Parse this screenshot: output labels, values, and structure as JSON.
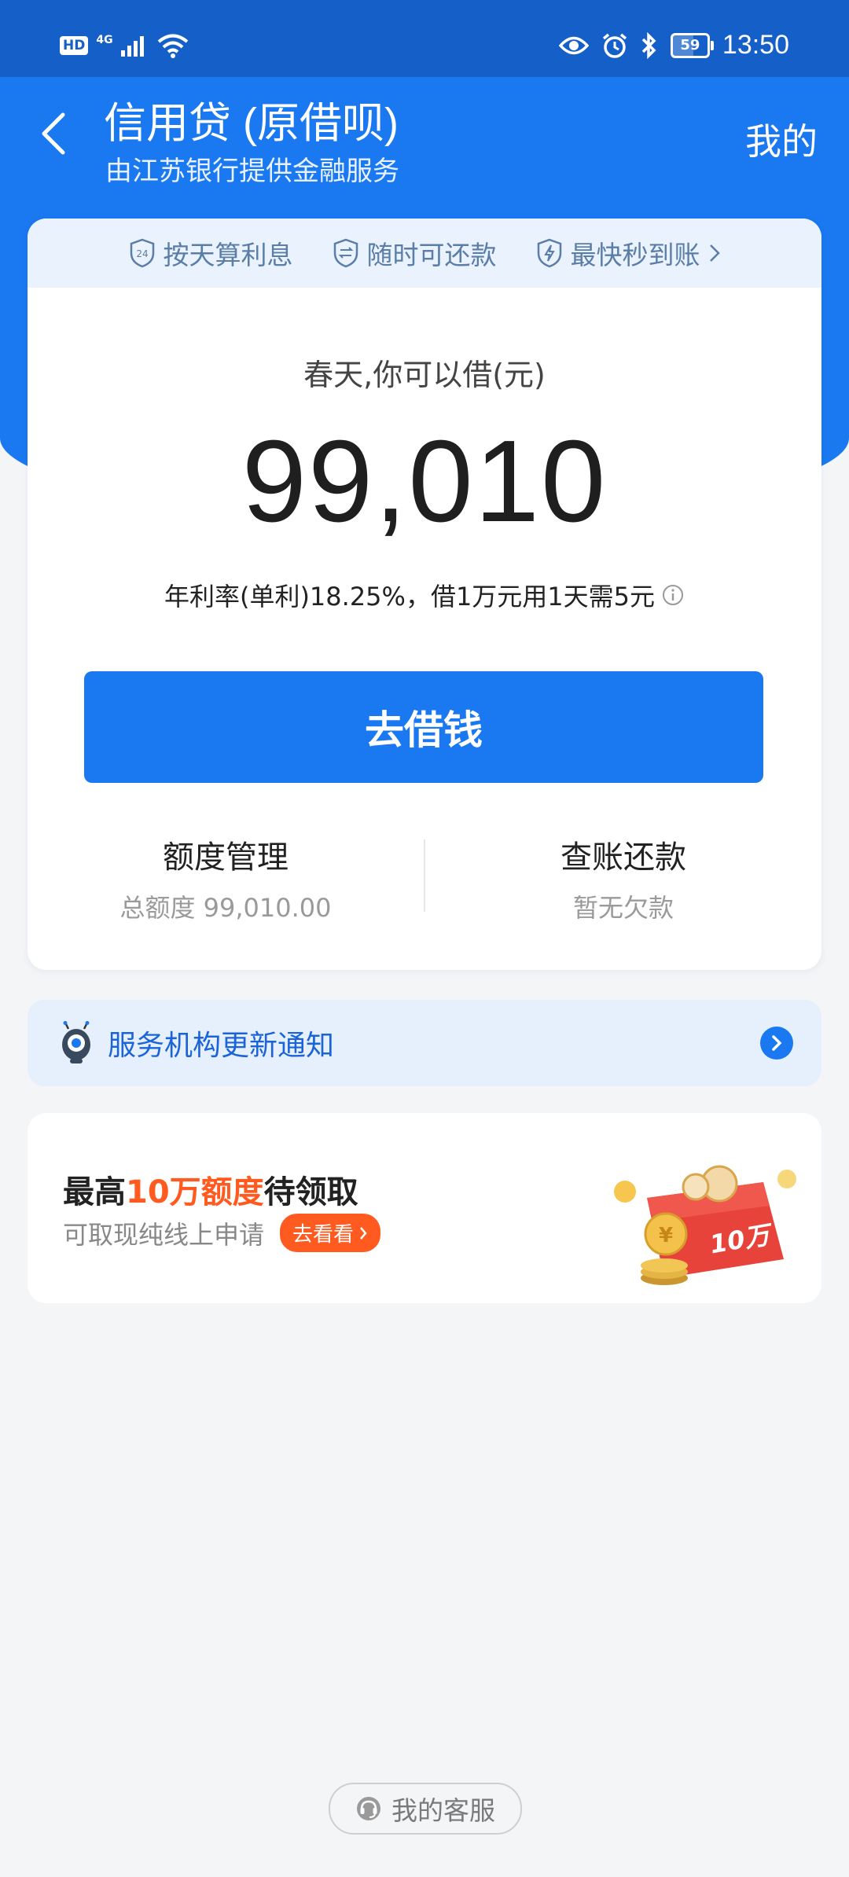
{
  "status_bar": {
    "hd": "HD",
    "network": "4G",
    "battery": "59",
    "battery_level": 0.59,
    "time": "13:50"
  },
  "header": {
    "title": "信用贷 (原借呗)",
    "subtitle": "由江苏银行提供金融服务",
    "my_link": "我的",
    "background_color": "#1a78f0"
  },
  "features": [
    {
      "icon": "24h-shield-icon",
      "label": "按天算利息"
    },
    {
      "icon": "exchange-shield-icon",
      "label": "随时可还款"
    },
    {
      "icon": "lightning-shield-icon",
      "label": "最快秒到账"
    }
  ],
  "loan": {
    "greeting": "春天,你可以借(元)",
    "amount": "99,010",
    "rate_text": "年利率(单利)18.25%，借1万元用1天需5元",
    "borrow_button": "去借钱"
  },
  "actions": {
    "limit_title": "额度管理",
    "limit_sub": "总额度 99,010.00",
    "repay_title": "查账还款",
    "repay_sub": "暂无欠款"
  },
  "notice": {
    "text": "服务机构更新通知"
  },
  "promo": {
    "title_prefix": "最高",
    "title_highlight": "10万额度",
    "title_suffix": "待领取",
    "subtitle": "可取现纯线上申请",
    "button": "去看看",
    "badge_text": "10万",
    "accent_color": "#ff5a1f"
  },
  "customer_service": {
    "label": "我的客服"
  }
}
